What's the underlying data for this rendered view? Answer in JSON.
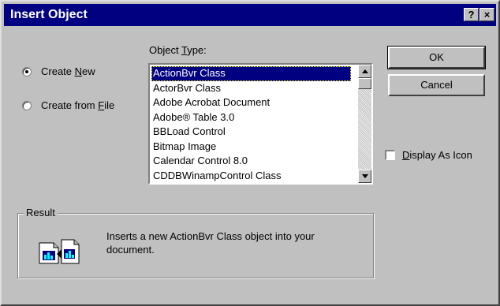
{
  "window": {
    "title": "Insert Object",
    "help_glyph": "?",
    "close_glyph": "×"
  },
  "options": {
    "create_new": {
      "pre": "Create ",
      "key": "N",
      "post": "ew",
      "checked": true
    },
    "create_from_file": {
      "pre": "Create from ",
      "key": "F",
      "post": "ile",
      "checked": false
    }
  },
  "object_type": {
    "label_pre": "Object ",
    "label_key": "T",
    "label_post": "ype:",
    "items": [
      "ActionBvr Class",
      "ActorBvr Class",
      "Adobe Acrobat Document",
      "Adobe® Table 3.0",
      "BBLoad Control",
      "Bitmap Image",
      "Calendar Control 8.0",
      "CDDBWinampControl Class"
    ],
    "selected_index": 0
  },
  "buttons": {
    "ok": "OK",
    "cancel": "Cancel"
  },
  "display_as_icon": {
    "key": "D",
    "rest": "isplay As Icon",
    "checked": false
  },
  "result": {
    "label": "Result",
    "text_line1": "Inserts a new ActionBvr Class object into your",
    "text_line2": "document."
  },
  "colors": {
    "titlebar": "#000080",
    "dialog": "#c0c0c0",
    "selection": "#000080"
  }
}
